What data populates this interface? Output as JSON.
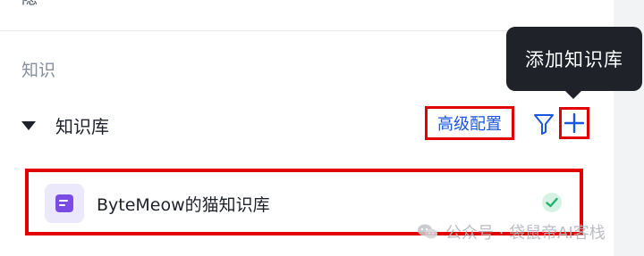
{
  "top_clipped_text": "隐 ˇ",
  "section": {
    "title": "知识"
  },
  "knowledge_base": {
    "header_label": "知识库",
    "advanced_config_label": "高级配置",
    "add_tooltip": "添加知识库",
    "items": [
      {
        "name": "ByteMeow的猫知识库",
        "status": "enabled"
      }
    ]
  },
  "watermark": {
    "text": "公众号 · 袋鼠帝AI客栈"
  },
  "colors": {
    "accent_blue": "#1a56e0",
    "highlight_red": "#e00000",
    "tooltip_bg": "#1f2329",
    "icon_purple": "#7b4be6",
    "check_green": "#23b26d"
  }
}
